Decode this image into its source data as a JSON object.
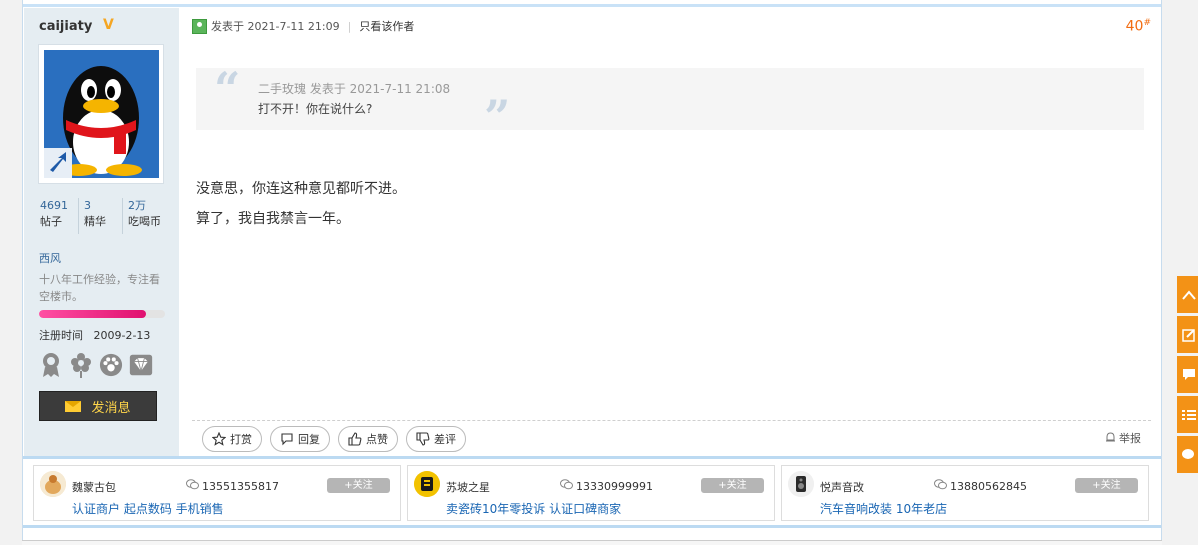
{
  "user": {
    "name": "caijiaty",
    "badge": "V",
    "stats": [
      {
        "value": "4691",
        "label": "帖子"
      },
      {
        "value": "3",
        "label": "精华"
      },
      {
        "value": "2万",
        "label": "吃喝币"
      }
    ],
    "group": "西风",
    "bio": "十八年工作经验，专注看空楼市。",
    "progress": 0.85,
    "reg_label": "注册时间",
    "reg_date": "2009-2-13",
    "medals": [
      "medal-icon",
      "flower-icon",
      "paw-icon",
      "diamond-icon"
    ],
    "message_label": "发消息"
  },
  "post": {
    "posted_at": "发表于 2021-7-11 21:09",
    "only_author": "只看该作者",
    "floor": "40",
    "floor_sup": "#",
    "quote": {
      "header": "二手玫瑰 发表于 2021-7-11 21:08",
      "text": "打不开！你在说什么?"
    },
    "lines": [
      "没意思，你连这种意见都听不进。",
      "算了，我自我禁言一年。"
    ],
    "actions": [
      {
        "label": "打赏",
        "icon": "star-icon"
      },
      {
        "label": "回复",
        "icon": "comment-icon"
      },
      {
        "label": "点赞",
        "icon": "thumbs-up-icon"
      },
      {
        "label": "差评",
        "icon": "thumbs-down-icon"
      }
    ],
    "report": "举报"
  },
  "ads": [
    {
      "name": "魏蒙古包",
      "phone": "13551355817",
      "follow": "+关注",
      "desc": "认证商户 起点数码 手机销售",
      "logo_color": "#f1d9b0"
    },
    {
      "name": "苏坡之星",
      "phone": "13330999991",
      "follow": "+关注",
      "desc": "卖瓷砖10年零投诉 认证口碑商家",
      "logo_color": "#f2c200"
    },
    {
      "name": "悦声音改",
      "phone": "13880562845",
      "follow": "+关注",
      "desc": "汽车音响改装 10年老店",
      "logo_color": "#eeeeee"
    }
  ],
  "colors": {
    "accent": "#f26c11",
    "link": "#1a66b3",
    "sidebar": "#e5edf2",
    "rightbar": "#f39216"
  }
}
